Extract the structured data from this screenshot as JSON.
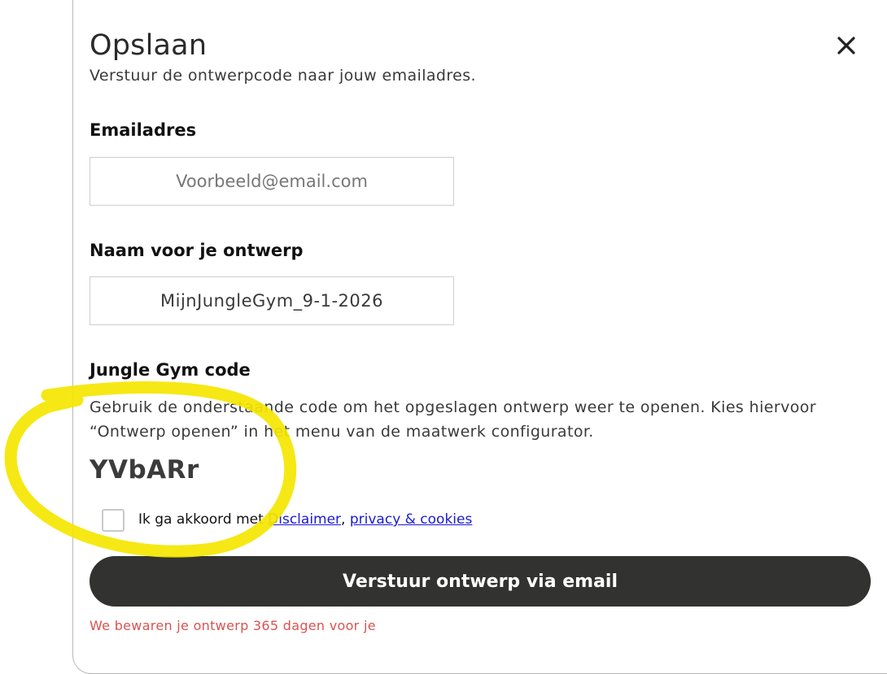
{
  "dialog": {
    "title": "Opslaan",
    "subtitle": "Verstuur de ontwerpcode naar jouw emailadres.",
    "close_icon": "close-icon"
  },
  "email": {
    "label": "Emailadres",
    "value": "",
    "placeholder": "Voorbeeld@email.com"
  },
  "design_name": {
    "label": "Naam voor je ontwerp",
    "value": "MijnJungleGym_9-1-2026"
  },
  "code_section": {
    "label": "Jungle Gym code",
    "description": "Gebruik de onderstaande code om het opgeslagen ontwerp weer te openen. Kies hiervoor “Ontwerp openen” in het menu van de maatwerk configurator.",
    "code": "YVbARr"
  },
  "consent": {
    "prefix": "Ik ga akkoord met ",
    "disclaimer_link": "Disclaimer",
    "separator": ", ",
    "privacy_link": "privacy & cookies",
    "checked": false
  },
  "submit": {
    "label": "Verstuur ontwerp via email"
  },
  "retention_note": "We bewaren je ontwerp 365 dagen voor je",
  "colors": {
    "button_bg": "#323331",
    "note_text": "#d9534f",
    "link": "#1a1ad6",
    "highlight_stroke": "#f5e600"
  }
}
